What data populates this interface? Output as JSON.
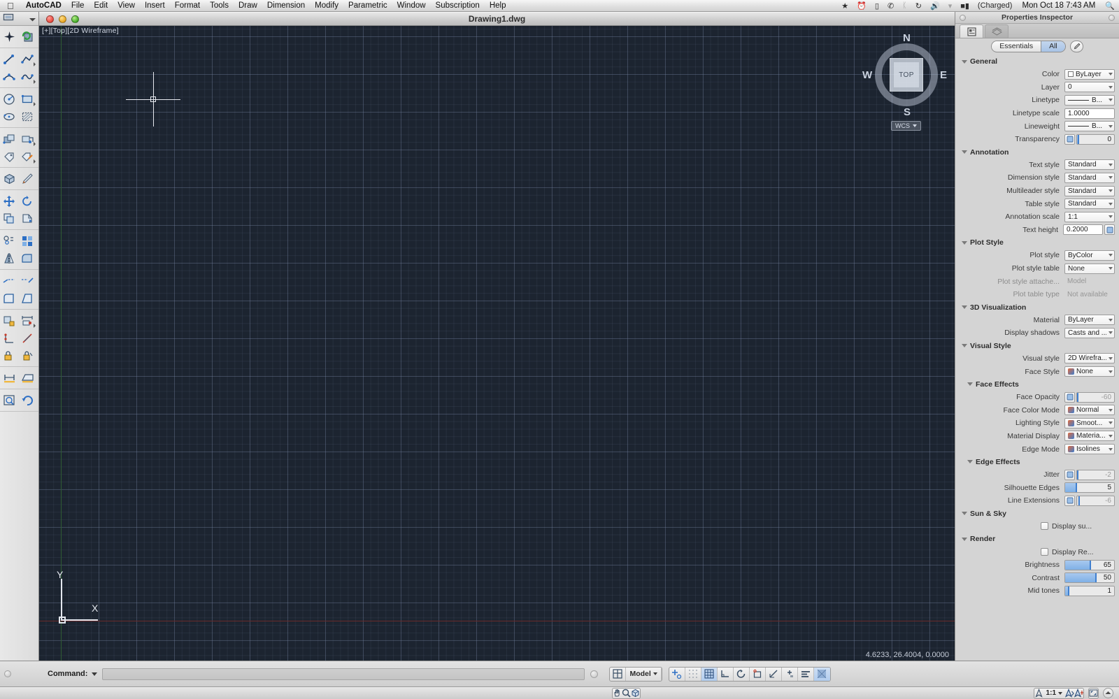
{
  "macmenu": {
    "apple": "apple-logo",
    "items": [
      "AutoCAD",
      "File",
      "Edit",
      "View",
      "Insert",
      "Format",
      "Tools",
      "Draw",
      "Dimension",
      "Modify",
      "Parametric",
      "Window",
      "Subscription",
      "Help"
    ],
    "status_icons": [
      "dropbox-icon",
      "alarm-icon",
      "display-icon",
      "phone-icon",
      "bluetooth-icon",
      "sync-icon",
      "volume-icon",
      "wifi-icon",
      "battery-icon"
    ],
    "battery_label": "(Charged)",
    "clock": "Mon Oct 18  7:43 AM",
    "spotlight": "search-icon"
  },
  "window": {
    "title": "Drawing1.dwg"
  },
  "viewport": {
    "label": "[+][Top][2D Wireframe]",
    "coords": "4.6233,  26.4004, 0.0000",
    "cube": {
      "face": "TOP",
      "north": "N",
      "south": "S",
      "west": "W",
      "east": "E",
      "wcs": "WCS"
    },
    "ucs": {
      "x": "X",
      "y": "Y"
    },
    "background": "#1c2430"
  },
  "lefttoolbar": {
    "header_icon": "toolset-icon",
    "header_caret": "chevron-down-icon",
    "groups": [
      {
        "rows": [
          [
            "snap-point-icon",
            "refresh-block-icon"
          ]
        ]
      },
      {
        "rows": [
          [
            "line-icon",
            "polyline-icon"
          ],
          [
            "arc-3pt-icon",
            "spline-icon"
          ]
        ]
      },
      {
        "rows": [
          [
            "circle-icon",
            "rectangle-icon"
          ],
          [
            "ellipse-icon",
            "hatch-icon"
          ]
        ]
      },
      {
        "rows": [
          [
            "block-insert-icon",
            "block-edit-icon"
          ],
          [
            "layer-tag-icon",
            "layer-paint-icon"
          ]
        ]
      },
      {
        "rows": [
          [
            "3d-box-icon",
            "pencil-icon"
          ]
        ]
      },
      {
        "rows": [
          [
            "move-icon",
            "rotate-icon"
          ],
          [
            "copy-icon",
            "mirror-copy-icon"
          ]
        ]
      },
      {
        "rows": [
          [
            "offset-icon",
            "array-icon"
          ],
          [
            "mirror-icon",
            "fillet-icon"
          ]
        ]
      },
      {
        "rows": [
          [
            "trim-icon",
            "extend-icon"
          ],
          [
            "chamfer-icon",
            "stretch-icon"
          ]
        ]
      },
      {
        "rows": [
          [
            "dim-linear-icon",
            "dim-aligned-icon"
          ],
          [
            "dim-baseline-icon",
            "dim-diameter-icon"
          ],
          [
            "dim-lock-icon",
            "dim-lock-angle-icon"
          ]
        ]
      },
      {
        "rows": [
          [
            "measure-icon",
            "area-icon"
          ]
        ]
      },
      {
        "rows": [
          [
            "zoom-extents-icon",
            "undo-icon"
          ]
        ]
      }
    ]
  },
  "properties": {
    "title": "Properties Inspector",
    "tabs": [
      "properties-tab",
      "layers-tab"
    ],
    "segmented": {
      "options": [
        "Essentials",
        "All"
      ],
      "selected": "All"
    },
    "eyedropper": "eyedropper-icon",
    "sections": [
      {
        "name": "General",
        "level": 0,
        "rows": [
          {
            "label": "Color",
            "value": "ByLayer",
            "kind": "dropdown",
            "icon": "color-swatch-white"
          },
          {
            "label": "Layer",
            "value": "0",
            "kind": "dropdown"
          },
          {
            "label": "Linetype",
            "value": "B...",
            "kind": "dropdown",
            "icon": "linetype-line"
          },
          {
            "label": "Linetype scale",
            "value": "1.0000",
            "kind": "text"
          },
          {
            "label": "Lineweight",
            "value": "B...",
            "kind": "dropdown",
            "icon": "linetype-line"
          },
          {
            "label": "Transparency",
            "value": "0",
            "kind": "slider-icon",
            "icon": "transparency-icon",
            "fill": 2
          }
        ]
      },
      {
        "name": "Annotation",
        "level": 0,
        "rows": [
          {
            "label": "Text style",
            "value": "Standard",
            "kind": "dropdown"
          },
          {
            "label": "Dimension style",
            "value": "Standard",
            "kind": "dropdown"
          },
          {
            "label": "Multileader style",
            "value": "Standard",
            "kind": "dropdown"
          },
          {
            "label": "Table style",
            "value": "Standard",
            "kind": "dropdown"
          },
          {
            "label": "Annotation scale",
            "value": "1:1",
            "kind": "dropdown"
          },
          {
            "label": "Text height",
            "value": "0.2000",
            "kind": "text-icon",
            "icon": "annotative-icon"
          }
        ]
      },
      {
        "name": "Plot Style",
        "level": 0,
        "rows": [
          {
            "label": "Plot style",
            "value": "ByColor",
            "kind": "dropdown"
          },
          {
            "label": "Plot style table",
            "value": "None",
            "kind": "dropdown"
          },
          {
            "label": "Plot style attache...",
            "value": "Model",
            "kind": "readonly"
          },
          {
            "label": "Plot table type",
            "value": "Not available",
            "kind": "readonly"
          }
        ]
      },
      {
        "name": "3D Visualization",
        "level": 0,
        "rows": [
          {
            "label": "Material",
            "value": "ByLayer",
            "kind": "dropdown"
          },
          {
            "label": "Display shadows",
            "value": "Casts and ...",
            "kind": "dropdown"
          }
        ]
      },
      {
        "name": "Visual Style",
        "level": 0,
        "rows": [
          {
            "label": "Visual style",
            "value": "2D Wirefra...",
            "kind": "dropdown"
          },
          {
            "label": "Face Style",
            "value": "None",
            "kind": "dropdown",
            "icon": "face-style-icon"
          }
        ]
      },
      {
        "name": "Face Effects",
        "level": 1,
        "rows": [
          {
            "label": "Face Opacity",
            "value": "-60",
            "kind": "slider-icon-disabled",
            "icon": "opacity-icon",
            "fill": 0
          },
          {
            "label": "Face Color Mode",
            "value": "Normal",
            "kind": "dropdown",
            "icon": "color-mode-icon"
          },
          {
            "label": "Lighting Style",
            "value": "Smoot...",
            "kind": "dropdown",
            "icon": "lighting-icon"
          },
          {
            "label": "Material Display",
            "value": "Materia...",
            "kind": "dropdown",
            "icon": "material-icon"
          },
          {
            "label": "Edge Mode",
            "value": "Isolines",
            "kind": "dropdown",
            "icon": "edge-mode-icon"
          }
        ]
      },
      {
        "name": "Edge Effects",
        "level": 1,
        "rows": [
          {
            "label": "Jitter",
            "value": "-2",
            "kind": "slider-icon-disabled",
            "icon": "jitter-icon",
            "fill": 0
          },
          {
            "label": "Silhouette Edges",
            "value": "5",
            "kind": "slider",
            "fill": 22
          },
          {
            "label": "Line Extensions",
            "value": "-6",
            "kind": "slider-icon-disabled",
            "icon": "line-ext-icon",
            "fill": 4
          }
        ]
      },
      {
        "name": "Sun & Sky",
        "level": 0,
        "checkboxes": [
          {
            "label": "Display su...",
            "checked": false
          }
        ],
        "rows": []
      },
      {
        "name": "Render",
        "level": 0,
        "checkboxes": [
          {
            "label": "Display Re...",
            "checked": false
          }
        ],
        "rows": [
          {
            "label": "Brightness",
            "value": "65",
            "kind": "slider",
            "fill": 50
          },
          {
            "label": "Contrast",
            "value": "50",
            "kind": "slider",
            "fill": 62
          },
          {
            "label": "Mid tones",
            "value": "1",
            "kind": "slider",
            "fill": 6
          }
        ]
      }
    ]
  },
  "commandbar": {
    "label": "Command:",
    "caret": "chevron-down-icon",
    "input_value": "",
    "input_placeholder": "",
    "layout_button": "layout-icon",
    "space_label": "Model",
    "space_caret": "chevron-down-icon",
    "toggles": [
      {
        "name": "osnap-icon",
        "on": false
      },
      {
        "name": "snapmode-icon",
        "on": false
      },
      {
        "name": "grid-icon",
        "on": true
      },
      {
        "name": "ortho-icon",
        "on": false
      },
      {
        "name": "polar-icon",
        "on": false
      },
      {
        "name": "object-snap-icon",
        "on": false
      },
      {
        "name": "otrack-icon",
        "on": false
      },
      {
        "name": "ducs-icon",
        "on": false
      },
      {
        "name": "dyn-icon",
        "on": false
      },
      {
        "name": "lineweight-icon",
        "on": true
      }
    ]
  },
  "statusbar": {
    "nav_tools": [
      {
        "name": "pan-icon",
        "on": false
      },
      {
        "name": "zoom-icon",
        "on": false
      },
      {
        "name": "orbit-icon",
        "on": true
      }
    ],
    "annotation_scale": "1:1",
    "scale_caret": "chevron-down-icon",
    "annotation_icons": [
      {
        "name": "annotation-scale-icon",
        "on": false
      },
      {
        "name": "annotation-visibility-icon",
        "on": true
      },
      {
        "name": "annotation-auto-add-icon",
        "on": true
      }
    ],
    "fullscreen_icon": "fullscreen-icon",
    "expand_icon": "chevron-up-icon"
  },
  "colors": {
    "canvas": "#1c2430",
    "grid_minor": "#2a3240",
    "grid_major": "#3b4556",
    "accent": "#7fb0e6",
    "chrome": "#d4d4d4"
  }
}
